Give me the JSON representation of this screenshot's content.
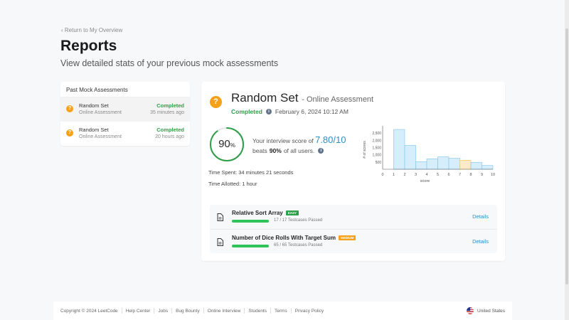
{
  "header": {
    "back_link": "‹ Return to My Overview",
    "title": "Reports",
    "subtitle": "View detailed stats of your previous mock assessments"
  },
  "past_assessments": {
    "title": "Past Mock Assessments",
    "items": [
      {
        "name": "Random Set",
        "type": "Online Assessment",
        "status": "Completed",
        "time": "35 minutes ago",
        "active": true
      },
      {
        "name": "Random Set",
        "type": "Online Assessment",
        "status": "Completed",
        "time": "20 hours ago",
        "active": false
      }
    ]
  },
  "report": {
    "title": "Random Set",
    "subtitle": "- Online Assessment",
    "status": "Completed",
    "date": "February 6, 2024 10:12 AM",
    "percentile": "90",
    "percentile_unit": "%",
    "percentile_value": 0.9,
    "score_prefix": "Your interview score of",
    "score": "7.80/10",
    "beats_prefix": "beats",
    "beats_value": "90%",
    "beats_suffix": "of all users.",
    "time_spent": "Time Spent: 34 minutes 21 seconds",
    "time_allotted": "Time Allotted: 1 hour"
  },
  "chart_data": {
    "type": "bar",
    "xlabel": "score",
    "ylabel": "# of scores",
    "xlim": [
      0,
      10
    ],
    "ylim": [
      0,
      3000
    ],
    "x_ticks": [
      "0",
      "1",
      "2",
      "3",
      "4",
      "5",
      "6",
      "7",
      "8",
      "9",
      "10"
    ],
    "y_ticks": [
      {
        "value": 500,
        "label": "500"
      },
      {
        "value": 1000,
        "label": "1,000"
      },
      {
        "value": 1500,
        "label": "1,500"
      },
      {
        "value": 2000,
        "label": "2,000"
      },
      {
        "value": 2500,
        "label": "2,500"
      }
    ],
    "bins": [
      {
        "start": 1,
        "end": 2,
        "value": 2750
      },
      {
        "start": 2,
        "end": 3,
        "value": 1650
      },
      {
        "start": 3,
        "end": 4,
        "value": 520
      },
      {
        "start": 4,
        "end": 5,
        "value": 720
      },
      {
        "start": 5,
        "end": 6,
        "value": 860
      },
      {
        "start": 6,
        "end": 7,
        "value": 760
      },
      {
        "start": 7,
        "end": 8,
        "value": 620
      },
      {
        "start": 8,
        "end": 9,
        "value": 480
      },
      {
        "start": 9,
        "end": 10,
        "value": 260
      }
    ],
    "highlight_bin": 6,
    "colors": {
      "bar": "#d6eefb",
      "bar_stroke": "#7cc4ea",
      "highlight": "#fdebc8",
      "highlight_stroke": "#f5c36b"
    }
  },
  "problems": [
    {
      "name": "Relative Sort Array",
      "difficulty": "EASY",
      "tests": "17 / 17 Testcases Passed",
      "pass_fraction": 1.0,
      "details": "Details"
    },
    {
      "name": "Number of Dice Rolls With Target Sum",
      "difficulty": "MEDIUM",
      "tests": "65 / 65 Testcases Passed",
      "pass_fraction": 1.0,
      "details": "Details"
    }
  ],
  "footer": {
    "links": [
      "Copyright © 2024 LeetCode",
      "Help Center",
      "Jobs",
      "Bug Bounty",
      "Online Interview",
      "Students",
      "Terms",
      "Privacy Policy"
    ],
    "region": "United States"
  },
  "colors": {
    "accent": "#2b8fc6",
    "success": "#2e9e4a",
    "warning": "#f7a11a"
  }
}
